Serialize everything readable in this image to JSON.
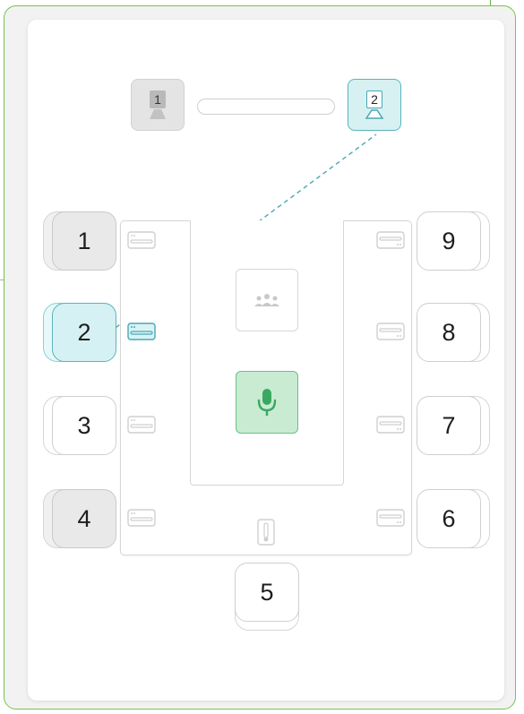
{
  "screens": [
    {
      "number": "1",
      "state": "inactive"
    },
    {
      "number": "2",
      "state": "active"
    }
  ],
  "screen_bar": {
    "icon": "screen-bar"
  },
  "seats_left": [
    {
      "number": "1",
      "state": "occupied"
    },
    {
      "number": "2",
      "state": "selected"
    },
    {
      "number": "3",
      "state": "empty"
    },
    {
      "number": "4",
      "state": "occupied"
    }
  ],
  "seats_right": [
    {
      "number": "9",
      "state": "empty"
    },
    {
      "number": "8",
      "state": "empty"
    },
    {
      "number": "7",
      "state": "empty"
    },
    {
      "number": "6",
      "state": "empty"
    }
  ],
  "seat_bottom": {
    "number": "5",
    "state": "empty"
  },
  "center": {
    "group_icon": "people-group-icon",
    "mic_icon": "microphone-icon",
    "mic_active": true
  },
  "bottom_device_icon": "thermometer-icon",
  "link": {
    "from_seat": "2",
    "to_screen": "2",
    "style": "dashed"
  },
  "colors": {
    "frame_border": "#7cc04f",
    "selected_fill": "#d6f1f3",
    "selected_border": "#5ab3bd",
    "mic_fill": "#c8ebd2",
    "mic_icon": "#3aa862",
    "dashed_line": "#4aa7b2"
  }
}
